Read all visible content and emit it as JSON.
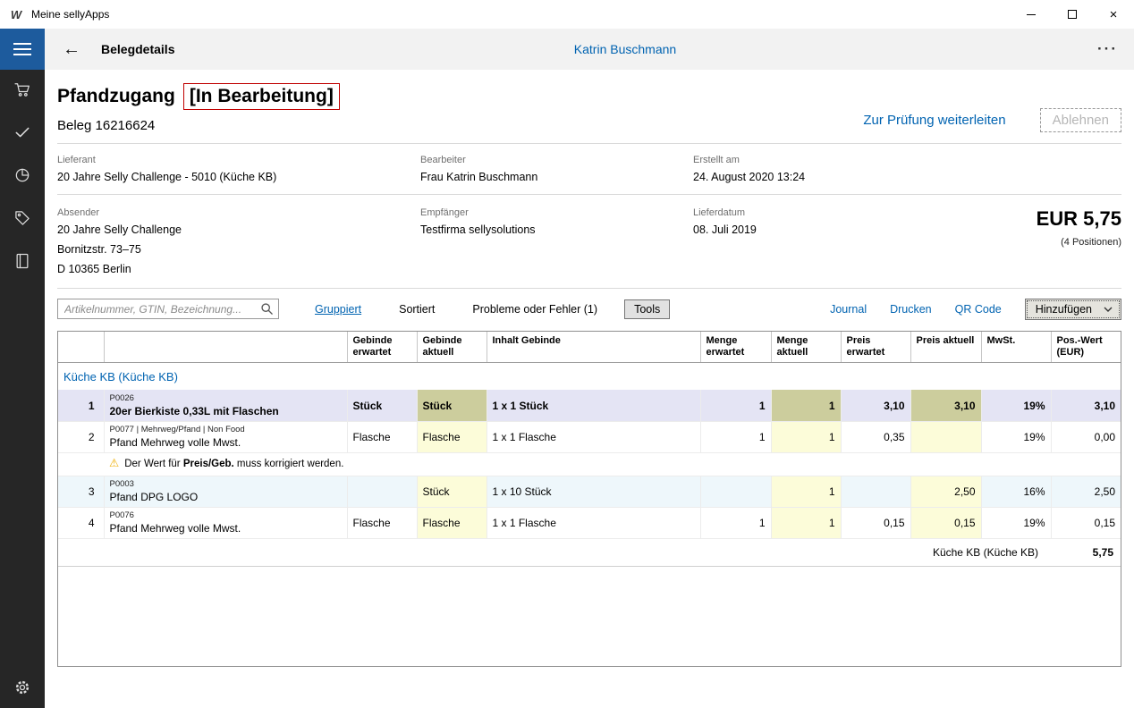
{
  "colors": {
    "accent_blue": "#0063b1",
    "nav_blue": "#1d5b9d",
    "status_border_red": "#c00000",
    "selected_row_bg": "#e4e4f4",
    "selected_cell_bg": "#cccd9d",
    "changed_cell_bg": "#fcfcd9",
    "alt_row_bg": "#eef7fb",
    "sidebar_bg": "#262626",
    "warning_yellow": "#efae00"
  },
  "window": {
    "title": "Meine sellyApps",
    "logo_glyph": "W",
    "close_glyph": "×"
  },
  "header": {
    "back_glyph": "←",
    "title": "Belegdetails",
    "user": "Katrin Buschmann",
    "more_glyph": "···"
  },
  "doc": {
    "title": "Pfandzugang",
    "status": "[In Bearbeitung]",
    "beleg": "Beleg 16216624",
    "forward_label": "Zur Prüfung weiterleiten",
    "reject_label": "Ablehnen"
  },
  "info": {
    "fields": [
      {
        "label": "Lieferant",
        "value": "20 Jahre Selly Challenge - 5010 (Küche KB)"
      },
      {
        "label": "Bearbeiter",
        "value": "Frau Katrin Buschmann"
      },
      {
        "label": "Erstellt am",
        "value": "24. August 2020 13:24"
      },
      {
        "label": "Absender",
        "value": "20 Jahre Selly Challenge",
        "line2": "Bornitzstr. 73–75",
        "line3": "D 10365 Berlin"
      },
      {
        "label": "Empfänger",
        "value": "Testfirma sellysolutions"
      },
      {
        "label": "Lieferdatum",
        "value": "08. Juli 2019"
      }
    ],
    "total": "EUR 5,75",
    "positions": "(4 Positionen)"
  },
  "toolbar": {
    "search_placeholder": "Artikelnummer, GTIN, Bezeichnung...",
    "gruppiert": "Gruppiert",
    "sortiert": "Sortiert",
    "probleme": "Probleme oder Fehler (1)",
    "tools": "Tools",
    "journal": "Journal",
    "drucken": "Drucken",
    "qr_code": "QR Code",
    "hinzufuegen": "Hinzufügen"
  },
  "table": {
    "headers": [
      "Gebinde erwartet",
      "Gebinde aktuell",
      "Inhalt Gebinde",
      "Menge erwartet",
      "Menge aktuell",
      "Preis erwartet",
      "Preis aktuell",
      "MwSt.",
      "Pos.-Wert (EUR)"
    ],
    "group": "Küche KB (Küche KB)",
    "rows": [
      {
        "num": "1",
        "code": "P0026",
        "name": "20er Bierkiste 0,33L mit Flaschen",
        "geb_erw": "Stück",
        "geb_akt": "Stück",
        "inhalt": "1 x 1 Stück",
        "menge_erw": "1",
        "menge_akt": "1",
        "preis_erw": "3,10",
        "preis_akt": "3,10",
        "mwst": "19%",
        "wert": "3,10"
      },
      {
        "num": "2",
        "code": "P0077 | Mehrweg/Pfand | Non Food",
        "name": "Pfand Mehrweg volle Mwst.",
        "geb_erw": "Flasche",
        "geb_akt": "Flasche",
        "inhalt": "1 x 1 Flasche",
        "menge_erw": "1",
        "menge_akt": "1",
        "preis_erw": "0,35",
        "preis_akt": "",
        "mwst": "19%",
        "wert": "0,00"
      },
      {
        "num": "3",
        "code": "P0003",
        "name": "Pfand DPG LOGO",
        "geb_erw": "",
        "geb_akt": "Stück",
        "inhalt": "1 x 10 Stück",
        "menge_erw": "",
        "menge_akt": "1",
        "preis_erw": "",
        "preis_akt": "2,50",
        "mwst": "16%",
        "wert": "2,50"
      },
      {
        "num": "4",
        "code": "P0076",
        "name": "Pfand Mehrweg volle Mwst.",
        "geb_erw": "Flasche",
        "geb_akt": "Flasche",
        "inhalt": "1 x 1 Flasche",
        "menge_erw": "1",
        "menge_akt": "1",
        "preis_erw": "0,15",
        "preis_akt": "0,15",
        "mwst": "19%",
        "wert": "0,15"
      }
    ],
    "warning": {
      "before": "Der Wert für ",
      "bold": "Preis/Geb.",
      "after": " muss korrigiert werden."
    },
    "footer": {
      "label": "Küche KB (Küche KB)",
      "value": "5,75"
    }
  }
}
